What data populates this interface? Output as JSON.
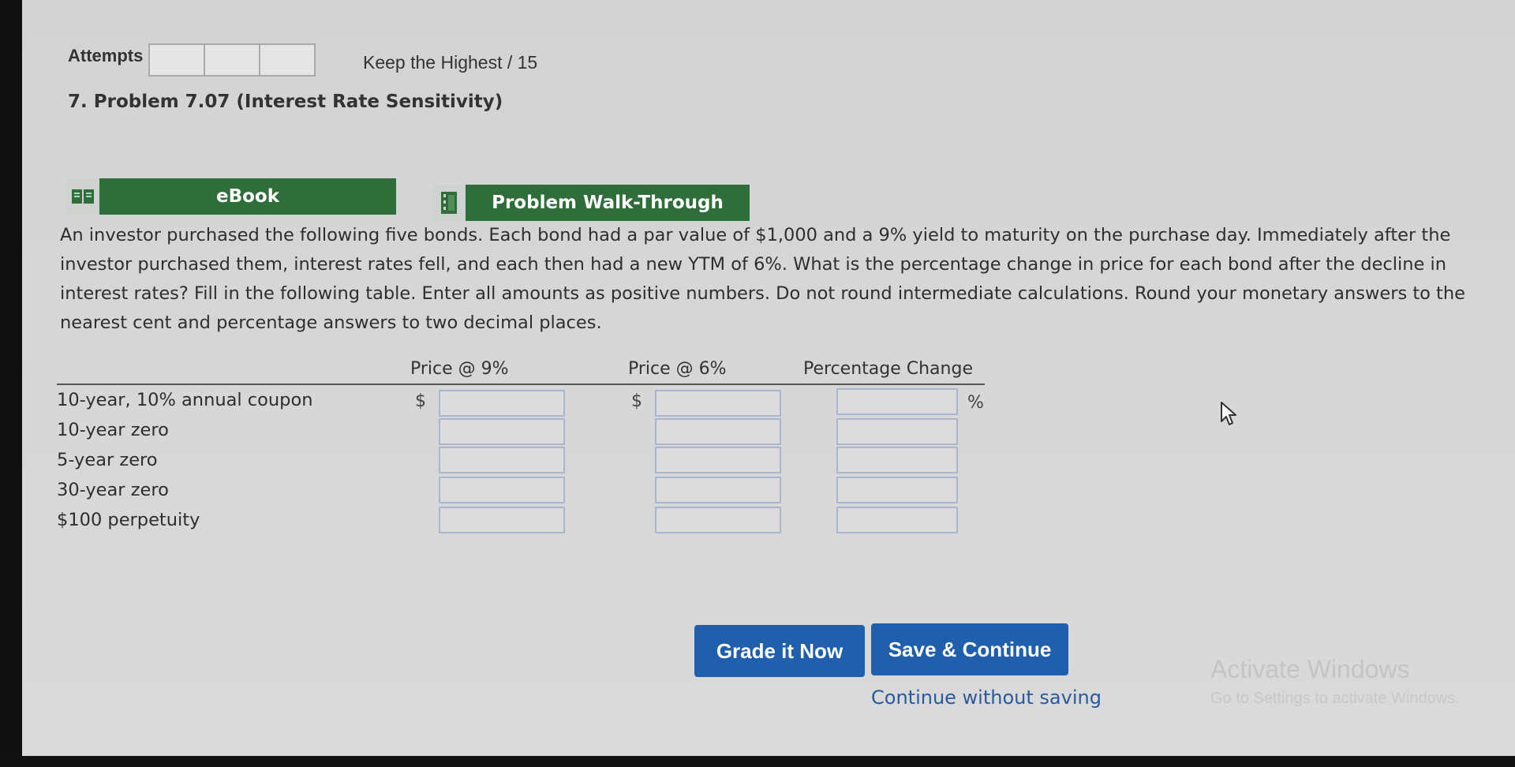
{
  "header": {
    "attempts_label": "Attempts",
    "attempt_box_count": 3,
    "keep_highest": "Keep the Highest / 15"
  },
  "problem": {
    "title": "7. Problem 7.07 (Interest Rate Sensitivity)",
    "tabs": [
      {
        "label": "eBook",
        "icon": "book-icon"
      },
      {
        "label": "Problem Walk-Through",
        "icon": "film-icon"
      }
    ],
    "question": "An investor purchased the following five bonds. Each bond had a par value of $1,000 and a 9% yield to maturity on the purchase day. Immediately after the investor purchased them, interest rates fell, and each then had a new YTM of 6%. What is the percentage change in price for each bond after the decline in interest rates? Fill in the following table. Enter all amounts as positive numbers. Do not round intermediate calculations. Round your monetary answers to the nearest cent and percentage answers to two decimal places."
  },
  "table": {
    "headers": [
      "Price @ 9%",
      "Price @ 6%",
      "Percentage Change"
    ],
    "currency_symbol": "$",
    "percent_symbol": "%",
    "rows": [
      {
        "label": "10-year, 10% annual coupon",
        "price9": "",
        "price6": "",
        "pct": ""
      },
      {
        "label": "10-year zero",
        "price9": "",
        "price6": "",
        "pct": ""
      },
      {
        "label": "5-year zero",
        "price9": "",
        "price6": "",
        "pct": ""
      },
      {
        "label": "30-year zero",
        "price9": "",
        "price6": "",
        "pct": ""
      },
      {
        "label": "$100 perpetuity",
        "price9": "",
        "price6": "",
        "pct": ""
      }
    ]
  },
  "actions": {
    "grade": "Grade it Now",
    "save": "Save & Continue",
    "continue_without_saving": "Continue without saving"
  },
  "watermark": {
    "title": "Activate Windows",
    "subtitle": "Go to Settings to activate Windows."
  },
  "colors": {
    "tab_green": "#2f6e3a",
    "button_blue": "#1f5fae",
    "link_blue": "#2a5a9c"
  }
}
